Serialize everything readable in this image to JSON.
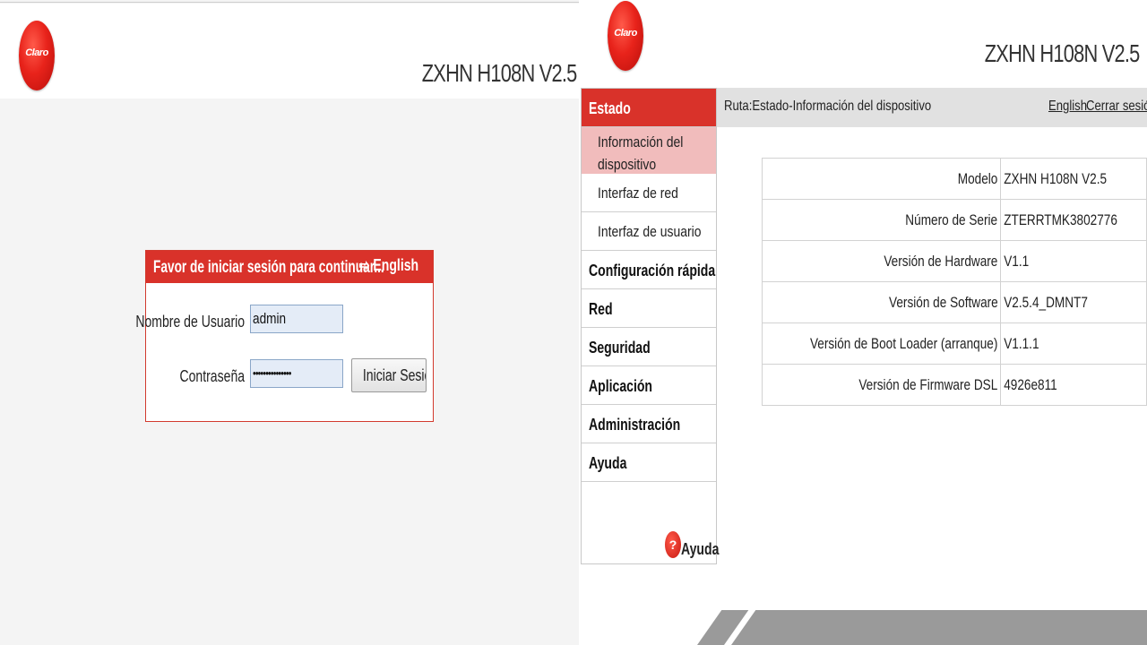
{
  "login": {
    "logo_text": "Claro",
    "model": "ZXHN H108N V2.5",
    "title": "Favor de iniciar sesión para continuar...",
    "language_link": "English",
    "username_label": "Nombre de Usuario",
    "username_value": "admin",
    "password_label": "Contraseña",
    "password_value": "•••••••••••••••",
    "login_button": "Iniciar Sesión"
  },
  "status": {
    "logo_text": "Claro",
    "model": "ZXHN H108N V2.5",
    "path": "Ruta:Estado-Información del dispositivo",
    "language_link": "English",
    "logout_link": "Cerrar sesión",
    "sidebar": {
      "estado": "Estado",
      "sub_items": [
        "Información del dispositivo",
        "Interfaz de red",
        "Interfaz de usuario"
      ],
      "sections": [
        "Configuración rápida",
        "Red",
        "Seguridad",
        "Aplicación",
        "Administración",
        "Ayuda"
      ],
      "help_label": "Ayuda"
    },
    "device_info": [
      {
        "key": "Modelo",
        "value": "ZXHN H108N V2.5"
      },
      {
        "key": "Número de Serie",
        "value": "ZTERRTMK3802776"
      },
      {
        "key": "Versión de Hardware",
        "value": "V1.1"
      },
      {
        "key": "Versión de Software",
        "value": "V2.5.4_DMNT7"
      },
      {
        "key": "Versión de Boot Loader (arranque)",
        "value": "V1.1.1"
      },
      {
        "key": "Versión de Firmware DSL",
        "value": "4926e811"
      }
    ]
  },
  "colors": {
    "brand_red": "#d9322a",
    "active_sub": "#f1bcbc"
  }
}
